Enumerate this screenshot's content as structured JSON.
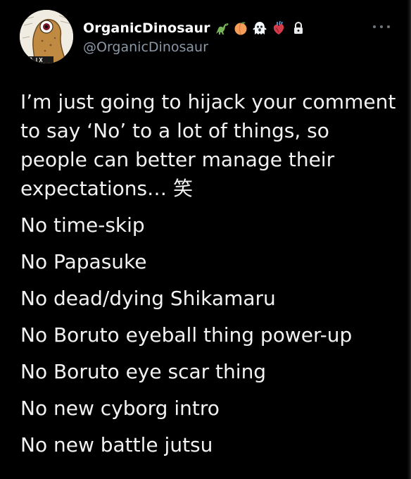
{
  "author": {
    "display_name": "OrganicDinosaur",
    "handle": "@OrganicDinosaur",
    "name_emojis": [
      "dinosaur-emoji",
      "peach-emoji",
      "ghost-emoji",
      "anatomical-heart-emoji"
    ],
    "protected_icon": "lock-icon",
    "avatar_icon": "one-eyed-creature-avatar"
  },
  "menu": {
    "icon": "more-options-icon"
  },
  "tweet": {
    "intro_lines": [
      "I’m just going to hijack your comment",
      "to say ‘No’ to a lot of things, so",
      "people can better manage their",
      "expectations… 笑"
    ],
    "items": [
      "No time-skip",
      "No Papasuke",
      "No dead/dying Shikamaru",
      "No Boruto eyeball thing power-up",
      "No Boruto eye scar thing",
      "No new cyborg intro",
      "No new battle jutsu"
    ]
  },
  "colors": {
    "background": "#000000",
    "text": "#e7e9ea",
    "handle": "#8b98a5"
  }
}
